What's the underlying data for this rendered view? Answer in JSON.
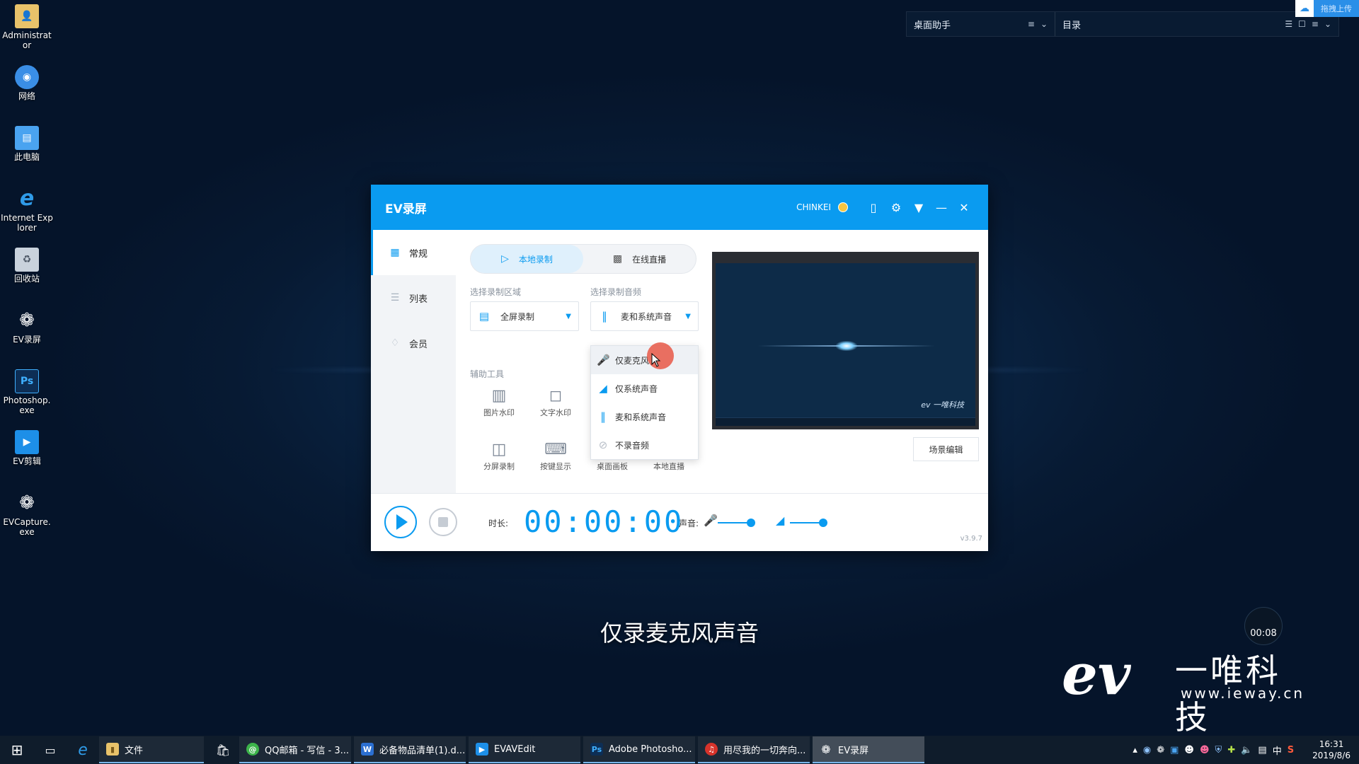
{
  "desktop": {
    "icons": [
      {
        "label": "Administrator",
        "icon": "folder-user-icon",
        "color": "#e8c26a"
      },
      {
        "label": "网络",
        "icon": "network-icon",
        "color": "#3a8ee6"
      },
      {
        "label": "此电脑",
        "icon": "computer-icon",
        "color": "#4aa3f0"
      },
      {
        "label": "Internet Explorer",
        "icon": "ie-icon",
        "color": "#2f9be8"
      },
      {
        "label": "回收站",
        "icon": "recycle-bin-icon",
        "color": "#c9d2dc"
      },
      {
        "label": "EV录屏",
        "icon": "ev-record-icon",
        "color": "#ffffff"
      },
      {
        "label": "Photoshop.exe",
        "icon": "photoshop-icon",
        "color": "#0d2e55"
      },
      {
        "label": "EV剪辑",
        "icon": "ev-edit-icon",
        "color": "#1d8fe8"
      },
      {
        "label": "EVCapture.exe",
        "icon": "ev-capture-icon",
        "color": "#ffffff"
      }
    ]
  },
  "widget": {
    "left_title": "桌面助手",
    "right_title": "目录",
    "upload_label": "拖拽上传"
  },
  "window": {
    "title": "EV录屏",
    "user": "CHINKEI",
    "sidebar": [
      {
        "label": "常规",
        "icon": "grid-icon",
        "active": true
      },
      {
        "label": "列表",
        "icon": "list-icon",
        "active": false
      },
      {
        "label": "会员",
        "icon": "diamond-icon",
        "active": false
      }
    ],
    "mode_tabs": [
      {
        "label": "本地录制",
        "active": true
      },
      {
        "label": "在线直播",
        "active": false
      }
    ],
    "region_label": "选择录制区域",
    "region_value": "全屏录制",
    "audio_label": "选择录制音频",
    "audio_value": "麦和系统声音",
    "audio_options": [
      {
        "label": "仅麦克风",
        "icon": "microphone-icon"
      },
      {
        "label": "仅系统声音",
        "icon": "speaker-icon"
      },
      {
        "label": "麦和系统声音",
        "icon": "sound-wave-icon"
      },
      {
        "label": "不录音频",
        "icon": "no-audio-icon"
      }
    ],
    "tools_label": "辅助工具",
    "tools": [
      {
        "label": "图片水印",
        "icon": "image-icon"
      },
      {
        "label": "文字水印",
        "icon": "text-icon"
      },
      {
        "label": "分屏录制",
        "icon": "split-screen-icon"
      },
      {
        "label": "按键显示",
        "icon": "keyboard-icon"
      },
      {
        "label": "桌面画板",
        "icon": "drawing-board-icon"
      },
      {
        "label": "本地直播",
        "icon": "live-icon"
      }
    ],
    "scene_button": "场景编辑",
    "preview_logo": "ev 一唯科技",
    "duration_label": "时长:",
    "timer": "00:00:00",
    "volume_label": "声音:",
    "mic_volume": 0.9,
    "system_volume": 0.9,
    "version": "v3.9.7"
  },
  "subtitle": "仅录麦克风声音",
  "badge_time": "00:08",
  "brand": {
    "logo": "ev",
    "name": "一唯科技",
    "url": "www.ieway.cn"
  },
  "taskbar": {
    "apps": [
      {
        "label": "文件",
        "icon": "folder-icon",
        "color": "#e8c26a",
        "active": false
      },
      {
        "label": "QQ邮箱 - 写信 - 3...",
        "icon": "qq-mail-icon",
        "color": "#3cb34a",
        "active": false
      },
      {
        "label": "必备物品清单(1).d...",
        "icon": "word-icon",
        "color": "#2b6fd1",
        "active": false
      },
      {
        "label": "EVAVEdit",
        "icon": "ev-edit-icon",
        "color": "#1d8fe8",
        "active": false
      },
      {
        "label": "Adobe Photosho...",
        "icon": "photoshop-icon",
        "color": "#0d2e55",
        "active": false
      },
      {
        "label": "用尽我的一切奔向...",
        "icon": "netease-music-icon",
        "color": "#d6332b",
        "active": false
      },
      {
        "label": "EV录屏",
        "icon": "ev-record-icon",
        "color": "#ffffff",
        "active": true
      }
    ],
    "tray_lang": "中",
    "time": "16:31",
    "date": "2019/8/6"
  }
}
